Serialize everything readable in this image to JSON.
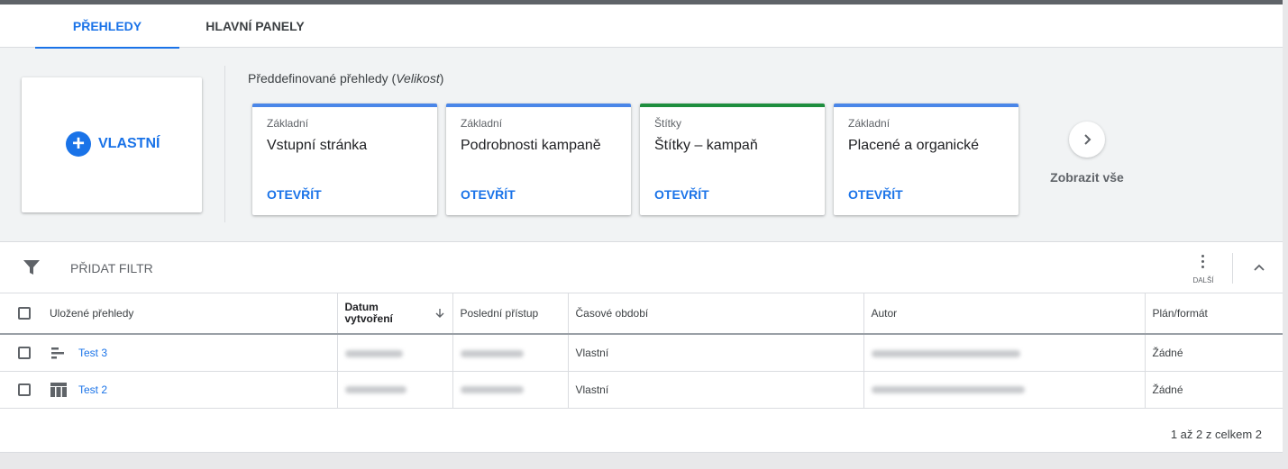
{
  "tabs": [
    {
      "label": "PŘEHLEDY",
      "active": true
    },
    {
      "label": "HLAVNÍ PANELY",
      "active": false
    }
  ],
  "custom": {
    "label": "VLASTNÍ",
    "icon": "plus-icon"
  },
  "predefined": {
    "title": "Předdefinované přehledy (",
    "title_em": "Velikost",
    "title_end": ")",
    "cards": [
      {
        "category": "Základní",
        "name": "Vstupní stránka",
        "open": "OTEVŘÍT",
        "color": "#4a86e8"
      },
      {
        "category": "Základní",
        "name": "Podrobnosti kampaně",
        "open": "OTEVŘÍT",
        "color": "#4a86e8"
      },
      {
        "category": "Štítky",
        "name": "Štítky – kampaň",
        "open": "OTEVŘÍT",
        "color": "#1e8e3e"
      },
      {
        "category": "Základní",
        "name": "Placené a organické",
        "open": "OTEVŘÍT",
        "color": "#4a86e8"
      }
    ],
    "show_all": "Zobrazit vše"
  },
  "toolbar": {
    "add_filter": "PŘIDAT FILTR",
    "more": "DALŠÍ"
  },
  "table": {
    "headers": {
      "name": "Uložené přehledy",
      "date_line1": "Datum",
      "date_line2": "vytvoření",
      "last": "Poslední přístup",
      "period": "Časové období",
      "author": "Autor",
      "plan": "Plán/formát"
    },
    "rows": [
      {
        "name": "Test 3",
        "icon": "bar-chart-icon",
        "period": "Vlastní",
        "plan": "Žádné"
      },
      {
        "name": "Test 2",
        "icon": "table-icon",
        "period": "Vlastní",
        "plan": "Žádné"
      }
    ]
  },
  "pager": "1 až 2 z celkem 2",
  "colors": {
    "accent": "#1a73e8",
    "green": "#1e8e3e",
    "card_top": "#4a86e8"
  }
}
